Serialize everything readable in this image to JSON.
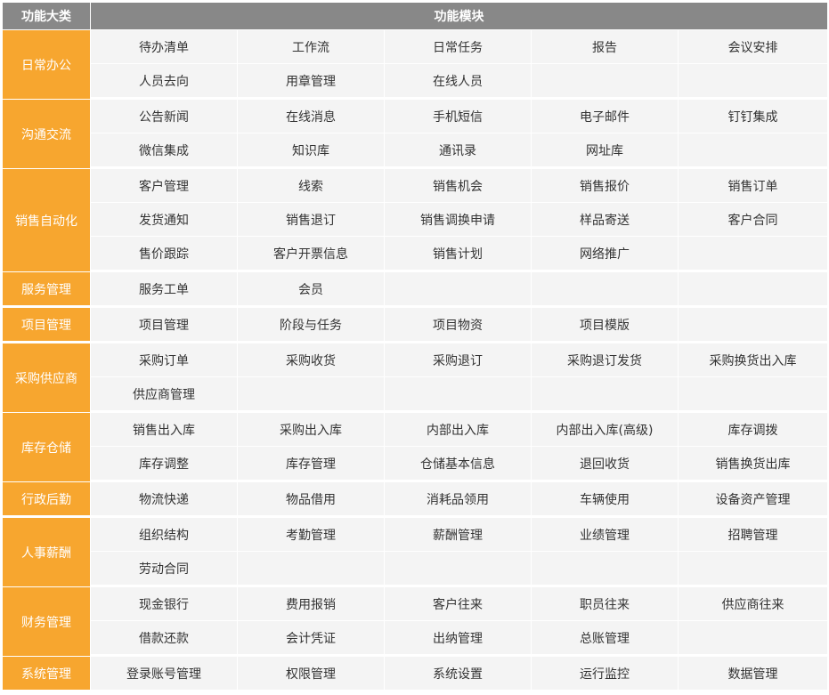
{
  "header": {
    "category_label": "功能大类",
    "module_label": "功能模块"
  },
  "colors": {
    "header_bg": "#888888",
    "category_bg": "#f7a62f",
    "cell_bg": "#f4f4f4",
    "text": "#333333"
  },
  "categories": [
    {
      "name": "日常办公",
      "rows": [
        [
          "待办清单",
          "工作流",
          "日常任务",
          "报告",
          "会议安排"
        ],
        [
          "人员去向",
          "用章管理",
          "在线人员",
          "",
          ""
        ]
      ]
    },
    {
      "name": "沟通交流",
      "rows": [
        [
          "公告新闻",
          "在线消息",
          "手机短信",
          "电子邮件",
          "钉钉集成"
        ],
        [
          "微信集成",
          "知识库",
          "通讯录",
          "网址库",
          ""
        ]
      ]
    },
    {
      "name": "销售自动化",
      "rows": [
        [
          "客户管理",
          "线索",
          "销售机会",
          "销售报价",
          "销售订单"
        ],
        [
          "发货通知",
          "销售退订",
          "销售调换申请",
          "样品寄送",
          "客户合同"
        ],
        [
          "售价跟踪",
          "客户开票信息",
          "销售计划",
          "网络推广",
          ""
        ]
      ]
    },
    {
      "name": "服务管理",
      "rows": [
        [
          "服务工单",
          "会员",
          "",
          "",
          ""
        ]
      ]
    },
    {
      "name": "项目管理",
      "rows": [
        [
          "项目管理",
          "阶段与任务",
          "项目物资",
          "项目模版",
          ""
        ]
      ]
    },
    {
      "name": "采购供应商",
      "rows": [
        [
          "采购订单",
          "采购收货",
          "采购退订",
          "采购退订发货",
          "采购换货出入库"
        ],
        [
          "供应商管理",
          "",
          "",
          "",
          ""
        ]
      ]
    },
    {
      "name": "库存仓储",
      "rows": [
        [
          "销售出入库",
          "采购出入库",
          "内部出入库",
          "内部出入库(高级)",
          "库存调拨"
        ],
        [
          "库存调整",
          "库存管理",
          "仓储基本信息",
          "退回收货",
          "销售换货出库"
        ]
      ]
    },
    {
      "name": "行政后勤",
      "rows": [
        [
          "物流快递",
          "物品借用",
          "消耗品领用",
          "车辆使用",
          "设备资产管理"
        ]
      ]
    },
    {
      "name": "人事薪酬",
      "rows": [
        [
          "组织结构",
          "考勤管理",
          "薪酬管理",
          "业绩管理",
          "招聘管理"
        ],
        [
          "劳动合同",
          "",
          "",
          "",
          ""
        ]
      ]
    },
    {
      "name": "财务管理",
      "rows": [
        [
          "现金银行",
          "费用报销",
          "客户往来",
          "职员往来",
          "供应商往来"
        ],
        [
          "借款还款",
          "会计凭证",
          "出纳管理",
          "总账管理",
          ""
        ]
      ]
    },
    {
      "name": "系统管理",
      "rows": [
        [
          "登录账号管理",
          "权限管理",
          "系统设置",
          "运行监控",
          "数据管理"
        ]
      ]
    }
  ]
}
